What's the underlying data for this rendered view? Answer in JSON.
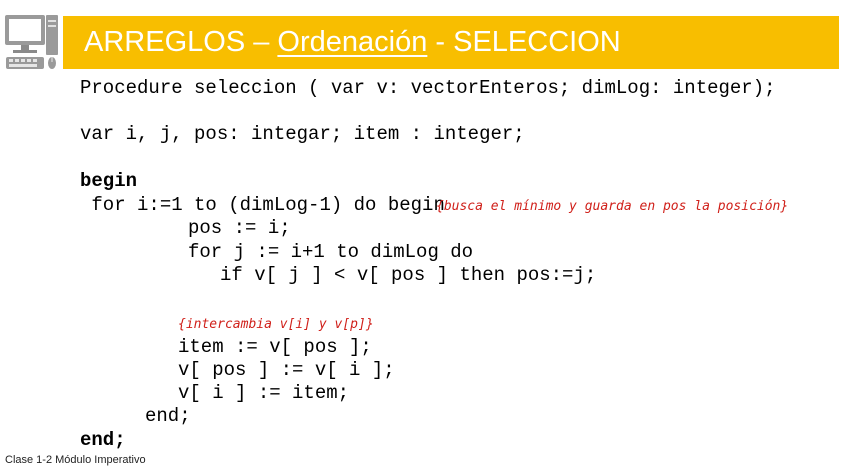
{
  "slide": {
    "title_prefix": "ARREGLOS – ",
    "title_underlined": "Ordenación",
    "title_suffix": " - SELECCION",
    "icon": "desktop-computer-icon",
    "accent_color": "#f8be00",
    "comment_color": "#d0201a"
  },
  "code": {
    "line1": "Procedure seleccion ( var v: vectorEnteros; dimLog: integer);",
    "line2": "var i, j, pos: integar; item : integer;",
    "line3": "begin",
    "line4": " for i:=1 to (dimLog-1) do begin",
    "comment1": "{busca el mínimo y guarda en pos la posición}",
    "line5": "pos := i;",
    "line6": "for j := i+1 to dimLog do",
    "line7": "if v[ j ] < v[ pos ] then pos:=j;",
    "comment2": "{intercambia v[i] y v[p]}",
    "line8": "item := v[ pos ];",
    "line9": "v[ pos ] := v[ i ];",
    "line10": "v[ i ] := item;",
    "line11": "end;",
    "line12": "end;"
  },
  "footer": {
    "text": "Clase 1-2 Módulo Imperativo"
  }
}
